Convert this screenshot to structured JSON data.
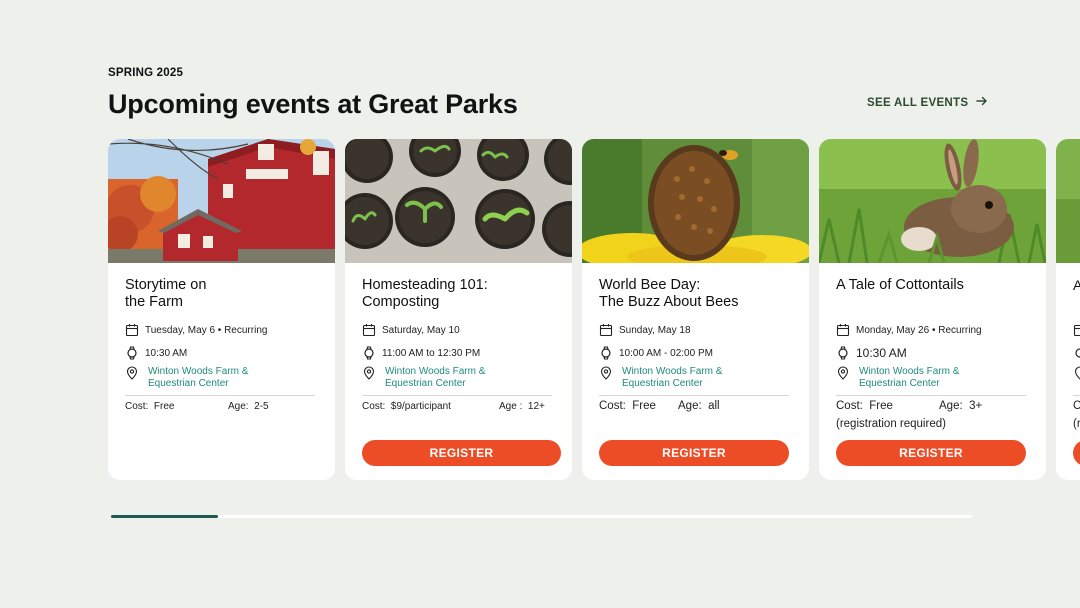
{
  "section": {
    "eyebrow": "SPRING 2025",
    "title": "Upcoming events at Great Parks",
    "see_all_label": "SEE ALL EVENTS"
  },
  "colors": {
    "accent": "#ec4d26",
    "location_link": "#1f8a7d",
    "progress_fill": "#1f5a50",
    "background": "#eef0ec"
  },
  "cards": [
    {
      "title": "Storytime on\nthe Farm",
      "date": "Tuesday, May 6 • Recurring",
      "time": "10:30 AM",
      "location": "Winton Woods Farm &\nEquestrian Center",
      "cost_label": "Cost:",
      "cost_value": "Free",
      "age_label": "Age:",
      "age_value": "2-5",
      "image": "red barn farm building"
    },
    {
      "title": "Homesteading 101:\nComposting",
      "date": "Saturday, May 10",
      "time": "11:00 AM to 12:30 PM",
      "location": "Winton Woods Farm &\nEquestrian Center",
      "cost_label": "Cost:",
      "cost_value": "$9/participant",
      "age_label": "Age :",
      "age_value": "12+",
      "register_label": "REGISTER",
      "image": "seedlings in pots"
    },
    {
      "title": "World Bee Day:\nThe Buzz About Bees",
      "date": "Sunday, May 18",
      "time": "10:00 AM - 02:00 PM",
      "location": "Winton Woods Farm &\nEquestrian Center",
      "cost_label": "Cost:",
      "cost_value": "Free",
      "age_label": "Age:",
      "age_value": "all",
      "register_label": "REGISTER",
      "image": "bee on flower"
    },
    {
      "title": "A Tale of Cottontails",
      "date": "Monday, May 26 • Recurring",
      "time": "10:30 AM",
      "location": "Winton Woods Farm &\nEquestrian Center",
      "cost_label": "Cost:",
      "cost_value": "Free",
      "age_label": "Age:",
      "age_value": "3+",
      "note": "(registration required)",
      "register_label": "REGISTER",
      "image": "cottontail rabbit in grass"
    }
  ],
  "peek_card": {
    "title_initial": "A",
    "cost_initial": "C",
    "note_initial": "(r"
  },
  "carousel": {
    "progress": 0.124
  }
}
